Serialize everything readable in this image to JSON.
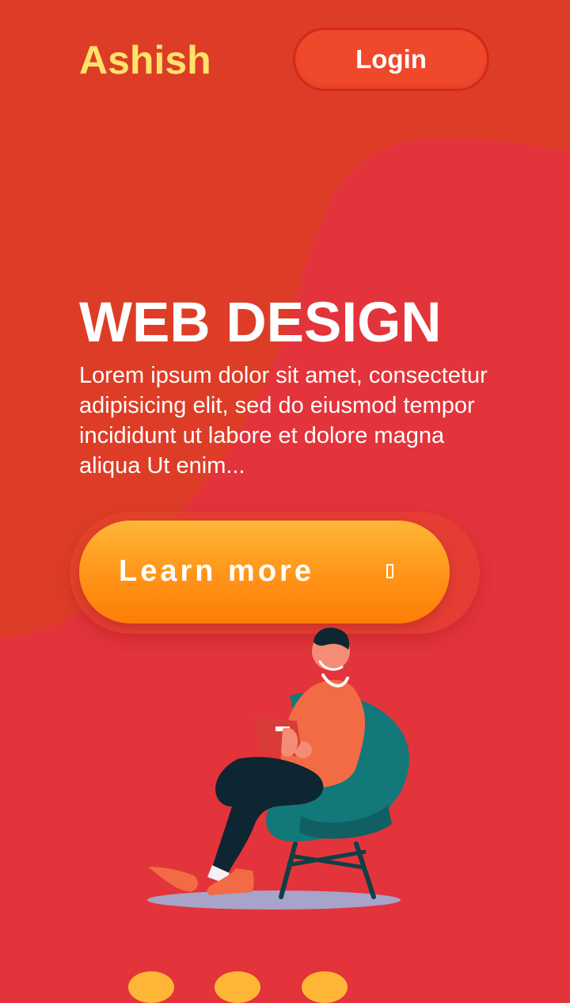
{
  "header": {
    "brand": "Ashish",
    "login_label": "Login"
  },
  "hero": {
    "title": "WEB DESIGN",
    "text": "Lorem ipsum dolor sit amet, consectetur adipisicing elit, sed do eiusmod tempor incididunt ut labore et dolore magna aliqua Ut enim...",
    "cta_label": "Learn more",
    "cta_icon": "arrow-right-icon"
  },
  "illustration": {
    "name": "man-reading-in-chair-illustration"
  },
  "colors": {
    "background": "#e2343a",
    "blob": "#dd3d27",
    "brand": "#ffe26a",
    "login_bg": "#f0482b",
    "cta_top": "#ffb637",
    "cta_bottom": "#ff7d06"
  }
}
